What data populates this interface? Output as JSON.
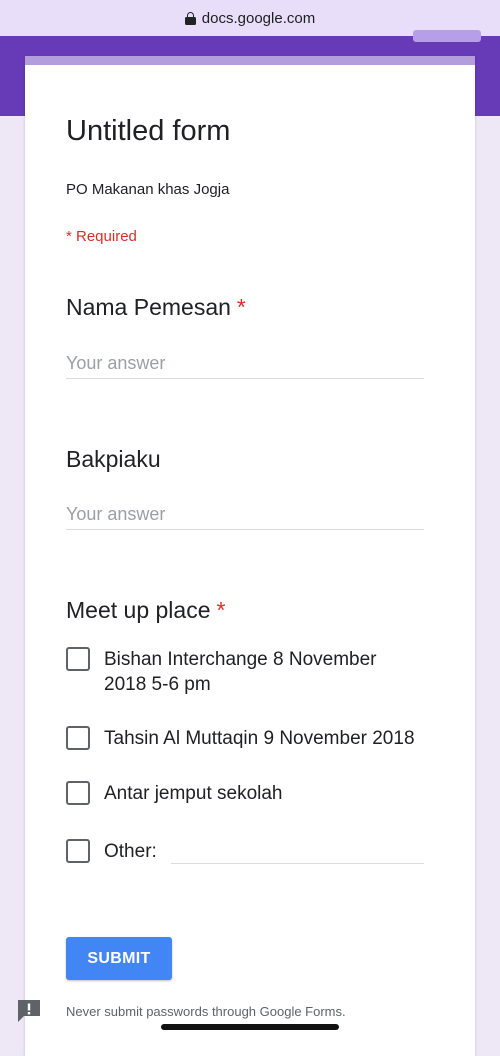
{
  "browser": {
    "url": "docs.google.com"
  },
  "form": {
    "title": "Untitled form",
    "description": "PO Makanan khas Jogja",
    "required_note": "* Required"
  },
  "questions": [
    {
      "title": "Nama Pemesan",
      "required_mark": "*",
      "placeholder": "Your answer"
    },
    {
      "title": "Bakpiaku",
      "placeholder": "Your answer"
    },
    {
      "title": "Meet up place",
      "required_mark": "*",
      "options": [
        "Bishan Interchange 8 November 2018 5-6 pm",
        "Tahsin Al Muttaqin 9 November 2018",
        "Antar jemput sekolah",
        "Other:"
      ]
    }
  ],
  "submit_label": "SUBMIT",
  "footer_note": "Never submit passwords through Google Forms.",
  "colors": {
    "header": "#673ab7",
    "accent_border": "#b39ddb",
    "submit": "#4285f4",
    "required": "#d93025",
    "page_bg": "#ede7f6"
  },
  "icons": [
    "lock-icon",
    "feedback-icon"
  ]
}
